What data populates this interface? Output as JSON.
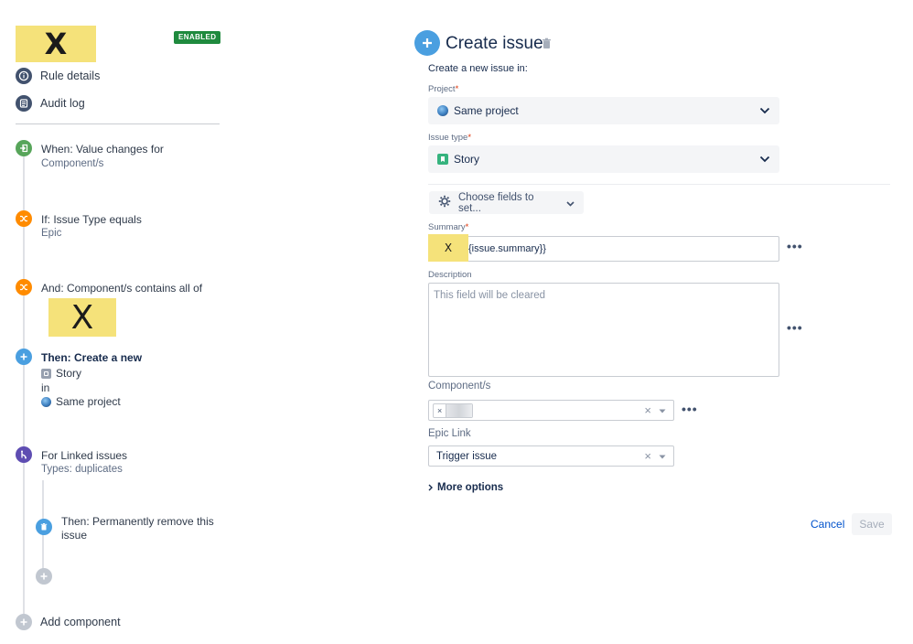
{
  "sidebar": {
    "rule_name": "X",
    "status_badge": "ENABLED",
    "nav": {
      "rule_details": "Rule details",
      "audit_log": "Audit log"
    },
    "steps": {
      "trigger_title": "When: Value changes for",
      "trigger_sub": "Component/s",
      "cond1_title": "If: Issue Type equals",
      "cond1_sub": "Epic",
      "cond2_title": "And: Component/s contains all of",
      "cond2_value": "X",
      "action_title": "Then: Create a new",
      "action_type": "Story",
      "action_in": "in",
      "action_project": "Same project",
      "branch_title": "For Linked issues",
      "branch_sub": "Types: duplicates",
      "branch_action_title": "Then: Permanently remove this issue"
    },
    "add_component": "Add component"
  },
  "form": {
    "title": "Create issue",
    "subtitle": "Create a new issue in:",
    "project_label": "Project",
    "project_value": "Same project",
    "issue_type_label": "Issue type",
    "issue_type_value": "Story",
    "choose_fields": "Choose fields to set...",
    "summary_label": "Summary",
    "summary_prefix": "X",
    "summary_value": "{issue.summary}}",
    "description_label": "Description",
    "description_placeholder": "This field will be cleared",
    "components_label": "Component/s",
    "epic_link_label": "Epic Link",
    "epic_link_value": "Trigger issue",
    "more_options": "More options",
    "cancel": "Cancel",
    "save": "Save",
    "required_mark": "*"
  },
  "colors": {
    "trigger_green": "#57a55a",
    "condition_orange": "#ff8b00",
    "action_blue": "#4a9fe0",
    "branch_purple": "#5e4db2",
    "nav_icon": "#42526e",
    "highlight_yellow": "#f5e27a",
    "enabled_green": "#1f8a3e"
  }
}
